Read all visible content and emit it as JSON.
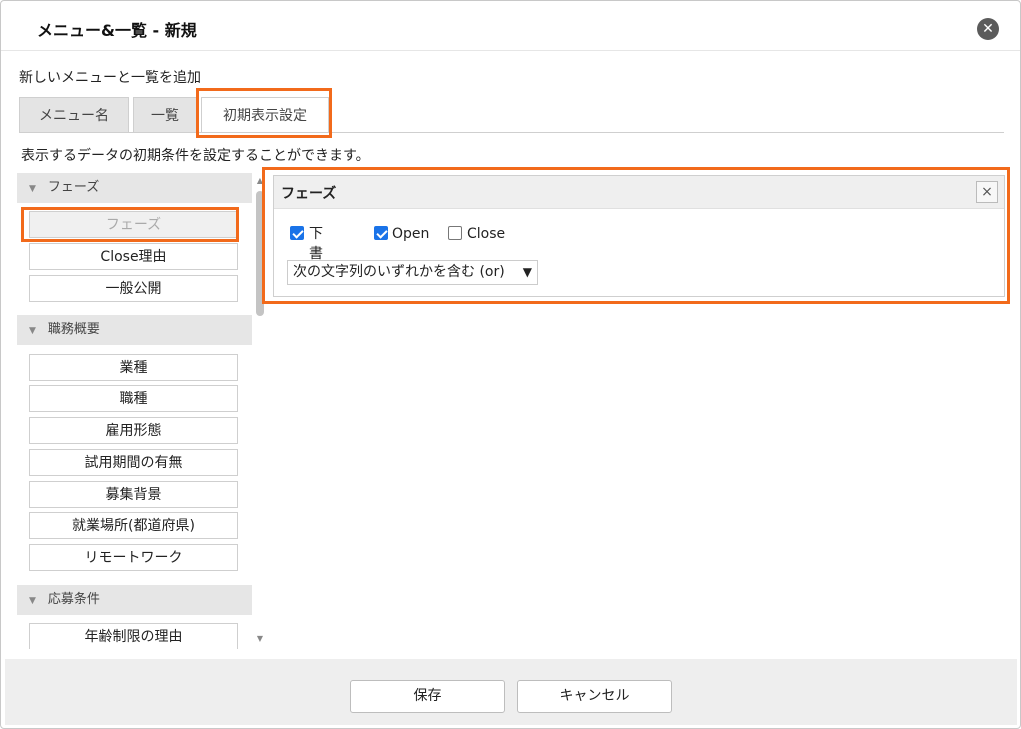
{
  "dialog": {
    "title": "メニュー&一覧 - 新規",
    "close_glyph": "✕",
    "subtitle": "新しいメニューと一覧を追加"
  },
  "tabs": [
    {
      "label": "メニュー名",
      "active": false
    },
    {
      "label": "一覧",
      "active": false
    },
    {
      "label": "初期表示設定",
      "active": true
    }
  ],
  "description": "表示するデータの初期条件を設定することができます。",
  "field_groups": [
    {
      "label": "フェーズ",
      "items": [
        {
          "label": "フェーズ",
          "disabled": true
        },
        {
          "label": "Close理由",
          "disabled": false
        },
        {
          "label": "一般公開",
          "disabled": false
        }
      ]
    },
    {
      "label": "職務概要",
      "items": [
        {
          "label": "業種"
        },
        {
          "label": "職種"
        },
        {
          "label": "雇用形態"
        },
        {
          "label": "試用期間の有無"
        },
        {
          "label": "募集背景"
        },
        {
          "label": "就業場所(都道府県)"
        },
        {
          "label": "リモートワーク"
        }
      ]
    },
    {
      "label": "応募条件",
      "items": [
        {
          "label": "年齢制限の理由"
        }
      ]
    }
  ],
  "filter": {
    "title": "フェーズ",
    "close_glyph": "×",
    "options": [
      {
        "label": "下書き",
        "checked": true
      },
      {
        "label": "Open",
        "checked": true
      },
      {
        "label": "Close",
        "checked": false
      }
    ],
    "match_mode": "次の文字列のいずれかを含む (or)"
  },
  "footer": {
    "save_label": "保存",
    "cancel_label": "キャンセル"
  },
  "colors": {
    "highlight": "#f26a1b",
    "checkbox_accent": "#1a73e8"
  }
}
